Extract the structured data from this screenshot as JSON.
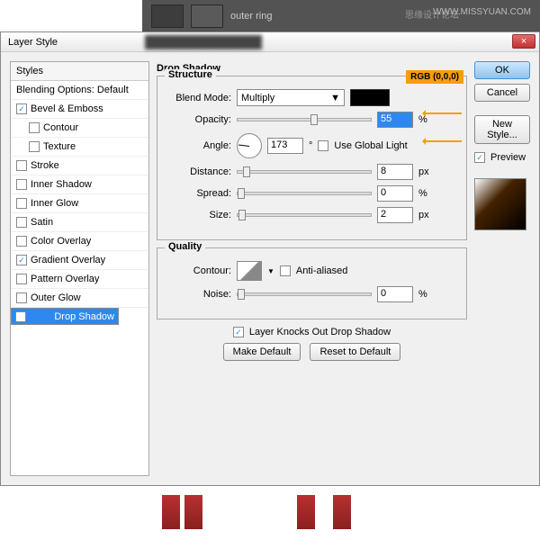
{
  "topbar": {
    "layerName": "outer ring"
  },
  "watermark": {
    "site": "WWW.MISSYUAN.COM",
    "forum": "思缘设计论坛"
  },
  "dialog": {
    "title": "Layer Style"
  },
  "styles": {
    "header": "Styles",
    "items": [
      {
        "label": "Blending Options: Default",
        "checked": false,
        "sel": false,
        "ind": false,
        "nocb": true
      },
      {
        "label": "Bevel & Emboss",
        "checked": true,
        "ind": false
      },
      {
        "label": "Contour",
        "checked": false,
        "ind": true
      },
      {
        "label": "Texture",
        "checked": false,
        "ind": true
      },
      {
        "label": "Stroke",
        "checked": false,
        "ind": false
      },
      {
        "label": "Inner Shadow",
        "checked": false,
        "ind": false
      },
      {
        "label": "Inner Glow",
        "checked": false,
        "ind": false
      },
      {
        "label": "Satin",
        "checked": false,
        "ind": false
      },
      {
        "label": "Color Overlay",
        "checked": false,
        "ind": false
      },
      {
        "label": "Gradient Overlay",
        "checked": true,
        "ind": false
      },
      {
        "label": "Pattern Overlay",
        "checked": false,
        "ind": false
      },
      {
        "label": "Outer Glow",
        "checked": false,
        "ind": false
      },
      {
        "label": "Drop Shadow",
        "checked": true,
        "ind": false,
        "sel": true
      }
    ]
  },
  "panel": {
    "title": "Drop Shadow",
    "structure": {
      "legend": "Structure",
      "blendModeLabel": "Blend Mode:",
      "blendMode": "Multiply",
      "opacityLabel": "Opacity:",
      "opacity": "55",
      "opacityUnit": "%",
      "angleLabel": "Angle:",
      "angle": "173",
      "angleUnit": "°",
      "globalLight": "Use Global Light",
      "globalLightChecked": false,
      "distanceLabel": "Distance:",
      "distance": "8",
      "distanceUnit": "px",
      "spreadLabel": "Spread:",
      "spread": "0",
      "spreadUnit": "%",
      "sizeLabel": "Size:",
      "size": "2",
      "sizeUnit": "px"
    },
    "quality": {
      "legend": "Quality",
      "contourLabel": "Contour:",
      "antiAliased": "Anti-aliased",
      "noiseLabel": "Noise:",
      "noise": "0",
      "noiseUnit": "%"
    },
    "knockout": "Layer Knocks Out Drop Shadow",
    "knockoutChecked": true,
    "makeDefault": "Make Default",
    "resetDefault": "Reset to Default"
  },
  "buttons": {
    "ok": "OK",
    "cancel": "Cancel",
    "newStyle": "New Style...",
    "preview": "Preview"
  },
  "annotation": {
    "rgb": "RGB (0,0,0)"
  }
}
